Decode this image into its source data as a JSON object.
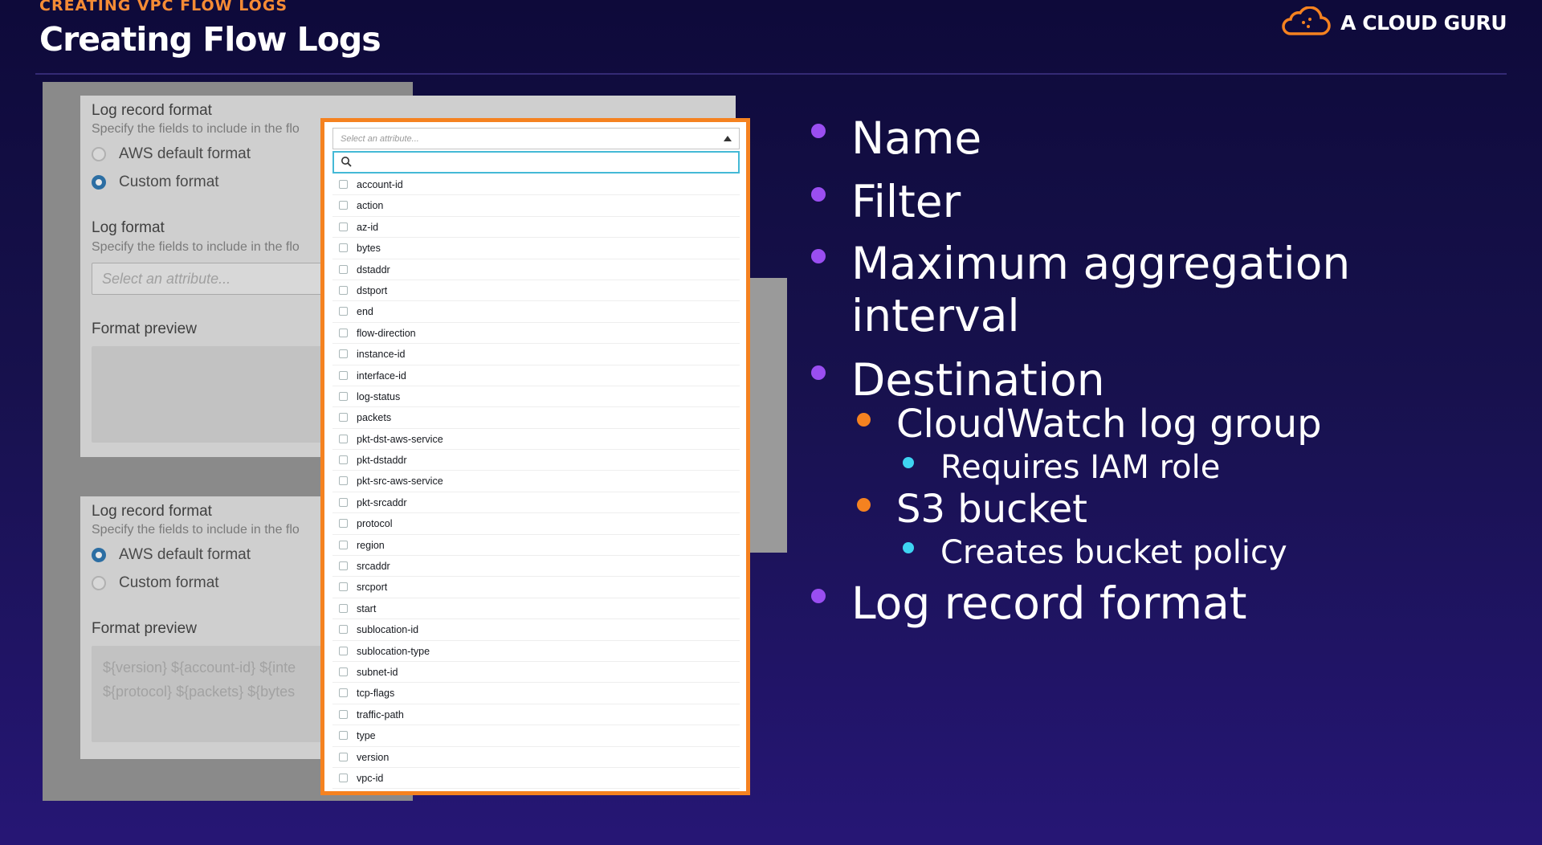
{
  "header": {
    "kicker": "CREATING VPC FLOW LOGS",
    "title": "Creating Flow Logs",
    "brand": "A CLOUD GURU"
  },
  "screenshot": {
    "top_card": {
      "heading": "Log record format",
      "desc": "Specify the fields to include in the flo",
      "options": [
        "AWS default format",
        "Custom format"
      ],
      "selected": "Custom format",
      "log_format_heading": "Log format",
      "log_format_desc": "Specify the fields to include in the flo",
      "select_placeholder": "Select an attribute...",
      "preview_heading": "Format preview"
    },
    "bottom_card": {
      "heading": "Log record format",
      "desc": "Specify the fields to include in the flo",
      "options": [
        "AWS default format",
        "Custom format"
      ],
      "selected": "AWS default format",
      "preview_heading": "Format preview",
      "preview_lines": [
        "${version} ${account-id} ${inte",
        "${protocol} ${packets} ${bytes"
      ]
    },
    "dropdown": {
      "placeholder": "Select an attribute...",
      "attributes": [
        "account-id",
        "action",
        "az-id",
        "bytes",
        "dstaddr",
        "dstport",
        "end",
        "flow-direction",
        "instance-id",
        "interface-id",
        "log-status",
        "packets",
        "pkt-dst-aws-service",
        "pkt-dstaddr",
        "pkt-src-aws-service",
        "pkt-srcaddr",
        "protocol",
        "region",
        "srcaddr",
        "srcport",
        "start",
        "sublocation-id",
        "sublocation-type",
        "subnet-id",
        "tcp-flags",
        "traffic-path",
        "type",
        "version",
        "vpc-id"
      ]
    }
  },
  "bullets": {
    "name": "Name",
    "filter": "Filter",
    "max_agg_1": "Maximum aggregation",
    "max_agg_2": "interval",
    "destination": "Destination",
    "cloudwatch": "CloudWatch log group",
    "iam_role": "Requires IAM role",
    "s3": "S3 bucket",
    "bucket_policy": "Creates bucket policy",
    "log_record_format": "Log record format"
  },
  "colors": {
    "accent_orange": "#f58220",
    "bullet_purple": "#9a4ef1",
    "bullet_cyan": "#3ed4f2"
  }
}
